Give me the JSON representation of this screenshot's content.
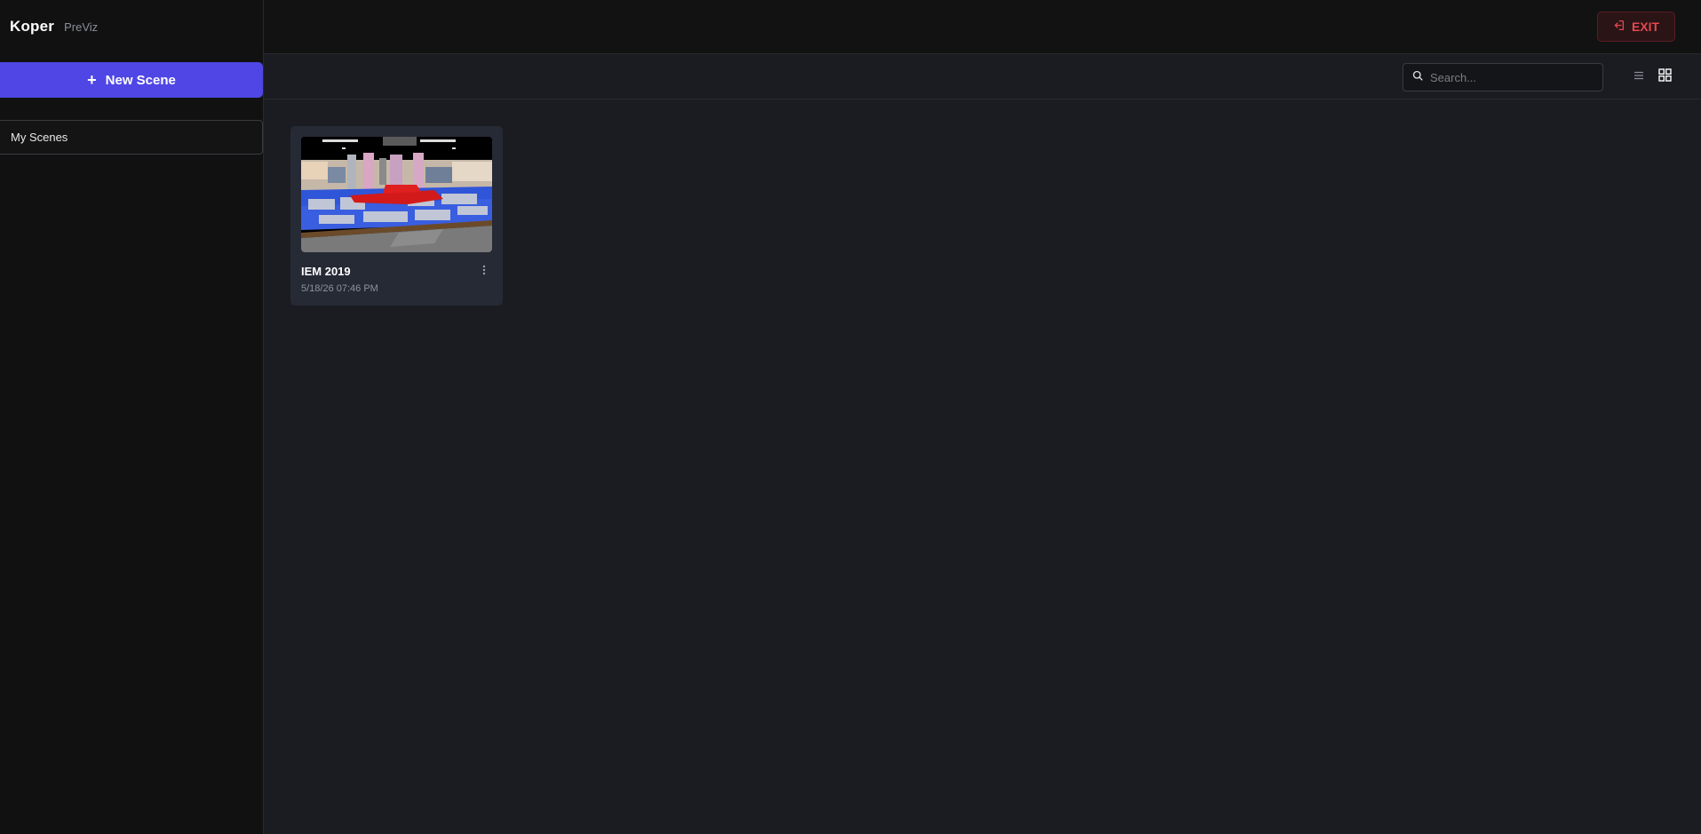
{
  "sidebar": {
    "brand_name": "Koper",
    "brand_sub": "PreViz",
    "new_scene_label": "New Scene",
    "nav": [
      {
        "label": "My Scenes",
        "active": true
      }
    ]
  },
  "header": {
    "exit_label": "EXIT",
    "exit_icon": "exit-icon"
  },
  "toolbar": {
    "search_placeholder": "Search...",
    "search_value": "",
    "view_modes": [
      {
        "icon": "list-view-icon",
        "active": false
      },
      {
        "icon": "grid-view-icon",
        "active": true
      }
    ]
  },
  "scenes": [
    {
      "title": "IEM 2019",
      "date": "5/18/26 07:46 PM",
      "thumbnail": "arena-3d-render",
      "menu_icon": "more-vertical-icon"
    }
  ],
  "colors": {
    "accent": "#4f46e5",
    "danger": "#e5484d",
    "background": "#1b1c21",
    "sidebar": "#111111",
    "card": "#262a35"
  }
}
